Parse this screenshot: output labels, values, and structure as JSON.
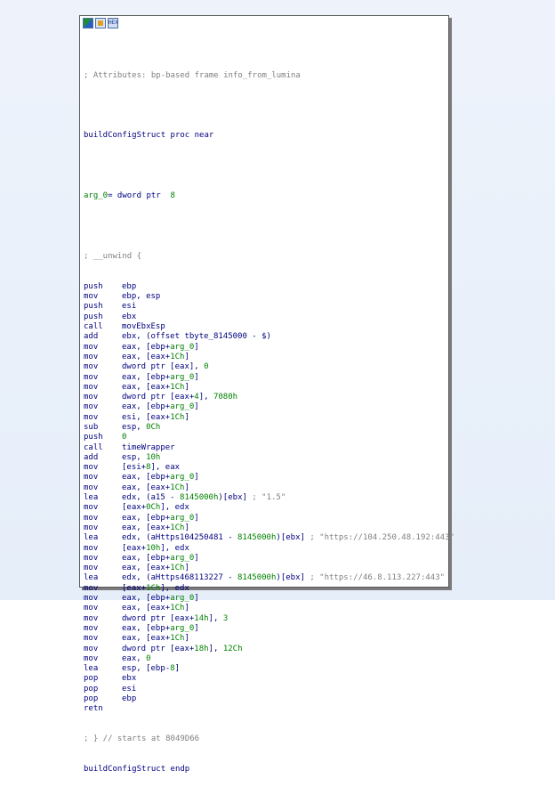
{
  "toolbar": {
    "buttons": [
      {
        "name": "graph-view",
        "icon": "graph-icon"
      },
      {
        "name": "proximity-view",
        "icon": "proximity-icon"
      },
      {
        "name": "hex-view",
        "icon": "hex-icon"
      }
    ],
    "hex_label": "HEX"
  },
  "colors": {
    "instruction": "#000080",
    "comment": "#808080",
    "number": "#008000",
    "background": "#ffffff"
  },
  "code": {
    "attributes_comment": "; Attributes: bp-based frame info_from_lumina",
    "proc_line": "buildConfigStruct proc near",
    "arg_var": "arg_0",
    "arg_def": "= dword ptr  ",
    "arg_val": "8",
    "unwind_line": "; __unwind {",
    "instructions": [
      {
        "m": "push",
        "o": "ebp"
      },
      {
        "m": "mov",
        "o": "ebp, esp"
      },
      {
        "m": "push",
        "o": "esi"
      },
      {
        "m": "push",
        "o": "ebx"
      },
      {
        "m": "call",
        "o": "movEbxEsp"
      },
      {
        "m": "add",
        "o": "ebx, (offset tbyte_8145000 - $)"
      },
      {
        "m": "mov",
        "o": "eax, [ebp+arg_0]"
      },
      {
        "m": "mov",
        "o": "eax, [eax+1Ch]"
      },
      {
        "m": "mov",
        "o": "dword ptr [eax], 0"
      },
      {
        "m": "mov",
        "o": "eax, [ebp+arg_0]"
      },
      {
        "m": "mov",
        "o": "eax, [eax+1Ch]"
      },
      {
        "m": "mov",
        "o": "dword ptr [eax+4], 7080h"
      },
      {
        "m": "mov",
        "o": "eax, [ebp+arg_0]"
      },
      {
        "m": "mov",
        "o": "esi, [eax+1Ch]"
      },
      {
        "m": "sub",
        "o": "esp, 0Ch"
      },
      {
        "m": "push",
        "o": "0"
      },
      {
        "m": "call",
        "o": "timeWrapper"
      },
      {
        "m": "add",
        "o": "esp, 10h"
      },
      {
        "m": "mov",
        "o": "[esi+8], eax"
      },
      {
        "m": "mov",
        "o": "eax, [ebp+arg_0]"
      },
      {
        "m": "mov",
        "o": "eax, [eax+1Ch]"
      },
      {
        "m": "lea",
        "o": "edx, (a15 - 8145000h)[ebx]",
        "c": " ; \"1.5\""
      },
      {
        "m": "mov",
        "o": "[eax+0Ch], edx"
      },
      {
        "m": "mov",
        "o": "eax, [ebp+arg_0]"
      },
      {
        "m": "mov",
        "o": "eax, [eax+1Ch]"
      },
      {
        "m": "lea",
        "o": "edx, (aHttps104250481 - 8145000h)[ebx]",
        "c": " ; \"https://104.250.48.192:443\""
      },
      {
        "m": "mov",
        "o": "[eax+10h], edx"
      },
      {
        "m": "mov",
        "o": "eax, [ebp+arg_0]"
      },
      {
        "m": "mov",
        "o": "eax, [eax+1Ch]"
      },
      {
        "m": "lea",
        "o": "edx, (aHttps468113227 - 8145000h)[ebx]",
        "c": " ; \"https://46.8.113.227:443\""
      },
      {
        "m": "mov",
        "o": "[eax+1Ch], edx"
      },
      {
        "m": "mov",
        "o": "eax, [ebp+arg_0]"
      },
      {
        "m": "mov",
        "o": "eax, [eax+1Ch]"
      },
      {
        "m": "mov",
        "o": "dword ptr [eax+14h], 3"
      },
      {
        "m": "mov",
        "o": "eax, [ebp+arg_0]"
      },
      {
        "m": "mov",
        "o": "eax, [eax+1Ch]"
      },
      {
        "m": "mov",
        "o": "dword ptr [eax+18h], 12Ch"
      },
      {
        "m": "mov",
        "o": "eax, 0"
      },
      {
        "m": "lea",
        "o": "esp, [ebp-8]"
      },
      {
        "m": "pop",
        "o": "ebx"
      },
      {
        "m": "pop",
        "o": "esi"
      },
      {
        "m": "pop",
        "o": "ebp"
      },
      {
        "m": "retn",
        "o": ""
      }
    ],
    "end_comment": "; } // starts at 8049D66",
    "endp_line": "buildConfigStruct endp"
  }
}
